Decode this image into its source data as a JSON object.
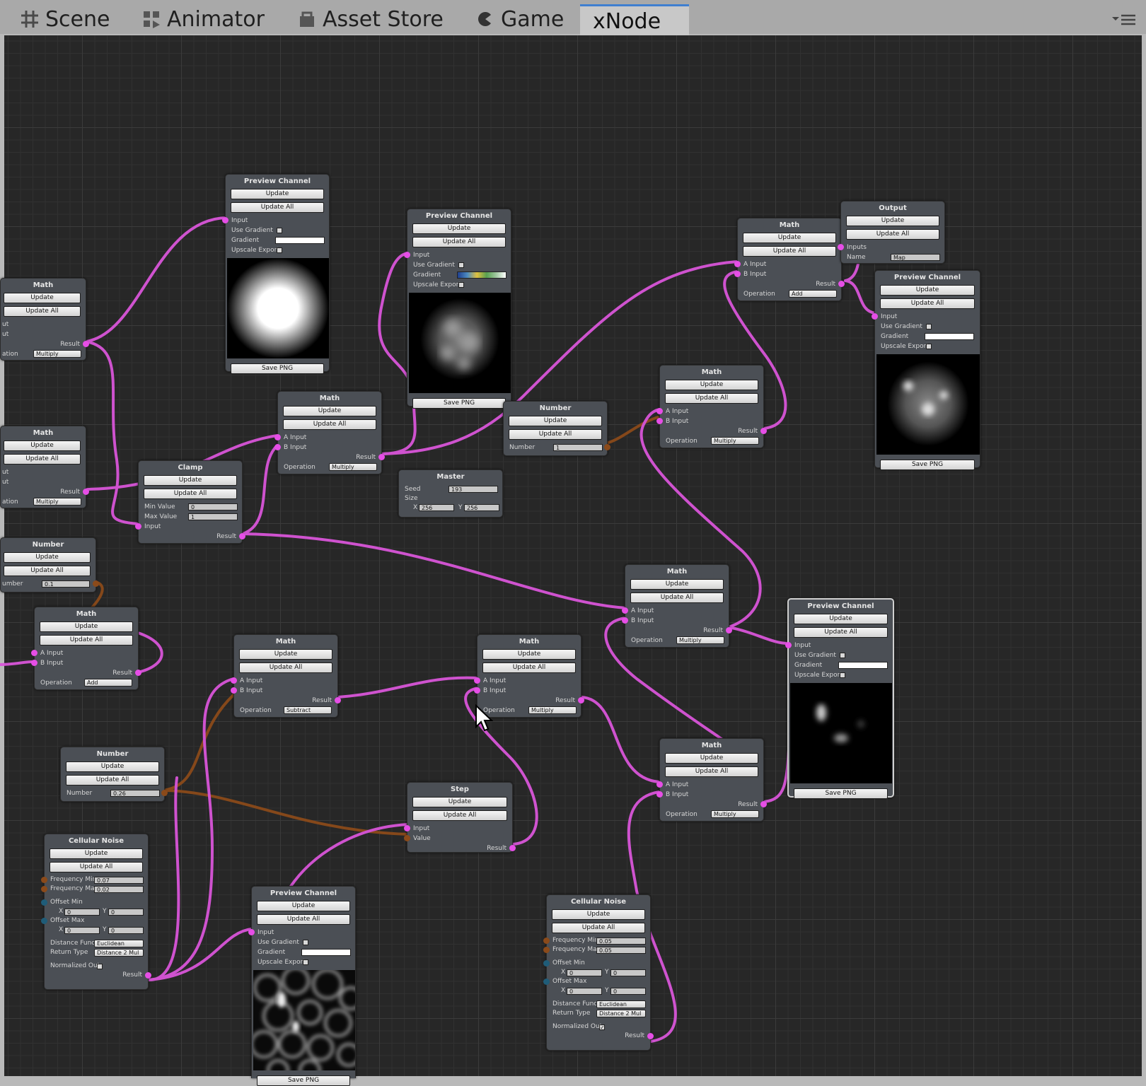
{
  "tabs": [
    {
      "label": "Scene",
      "icon": "grid-icon"
    },
    {
      "label": "Animator",
      "icon": "animator-icon"
    },
    {
      "label": "Asset Store",
      "icon": "store-icon"
    },
    {
      "label": "Game",
      "icon": "game-icon"
    },
    {
      "label": "xNode",
      "icon": ""
    }
  ],
  "active_tab": "xNode",
  "common": {
    "update": "Update",
    "update_all": "Update All",
    "save_png": "Save PNG",
    "input": "Input",
    "use_gradient": "Use Gradient",
    "gradient": "Gradient",
    "upscale_export": "Upscale Export",
    "a_input": "A Input",
    "b_input": "B Input",
    "result": "Result",
    "operation": "Operation",
    "number": "Number"
  },
  "titles": {
    "preview": "Preview Channel",
    "math": "Math",
    "number": "Number",
    "clamp": "Clamp",
    "master": "Master",
    "output": "Output",
    "step": "Step",
    "cellular": "Cellular Noise"
  },
  "ops": {
    "multiply": "Multiply",
    "add": "Add",
    "subtract": "Subtract"
  },
  "partial": {
    "ut": "ut",
    "ation": "ation",
    "umber": "umber"
  },
  "clamp": {
    "min_label": "Min Value",
    "min": "0",
    "max_label": "Max Value",
    "max": "1"
  },
  "master": {
    "seed_label": "Seed",
    "seed": "193",
    "size_label": "Size",
    "x_label": "X",
    "x": "256",
    "y_label": "Y",
    "y": "256"
  },
  "output": {
    "inputs_label": "Inputs",
    "name_label": "Name",
    "name": "Map"
  },
  "step": {
    "input": "Input",
    "value": "Value"
  },
  "numbers": {
    "n_top": "1",
    "n_left": "0.1",
    "n_bottom": "0.26"
  },
  "cellular": {
    "freq_min_label": "Frequency Min",
    "freq_max_label": "Frequency Max",
    "offset_min_label": "Offset Min",
    "offset_max_label": "Offset Max",
    "x_label": "X",
    "y_label": "Y",
    "dist_label": "Distance Functic",
    "return_label": "Return Type",
    "normalized_label": "Normalized Out",
    "dist": "Euclidean",
    "return": "Distance 2 Mul",
    "left": {
      "freq_min": "0.07",
      "freq_max": "0.02",
      "omin_x": "0",
      "omin_y": "0",
      "omax_x": "0",
      "omax_y": "0"
    },
    "right": {
      "freq_min": "0.05",
      "freq_max": "0.05",
      "omin_x": "0",
      "omin_y": "0",
      "omax_x": "0",
      "omax_y": "0"
    }
  },
  "colors": {
    "connection": "#d855d8",
    "connection_float": "#8b4a1a",
    "canvas_bg": "#272727",
    "node_bg": "#4b4f55",
    "active_tab_accent": "#3f7fd0"
  }
}
